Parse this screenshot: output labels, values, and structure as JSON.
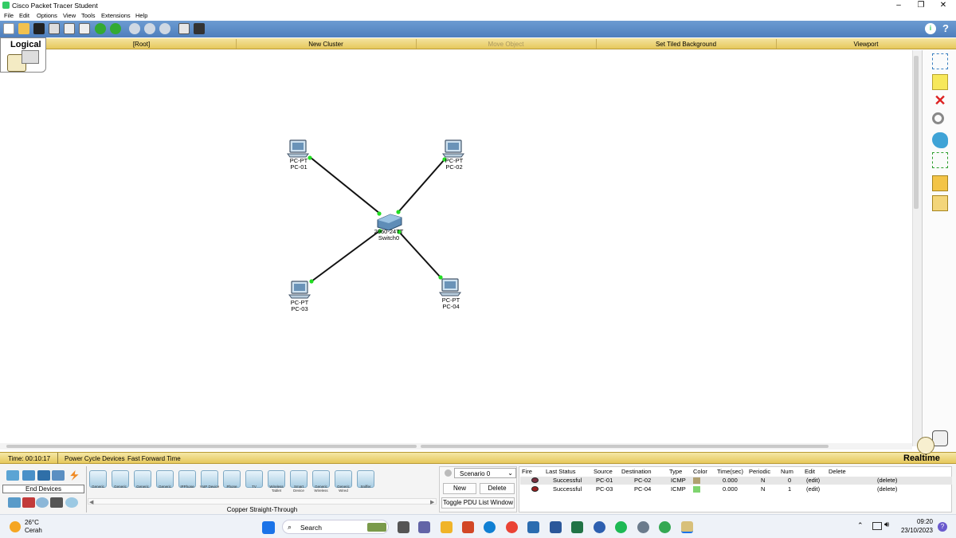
{
  "window": {
    "title": "Cisco Packet Tracer Student",
    "min": "–",
    "max": "❐",
    "close": "✕"
  },
  "menu": [
    "File",
    "Edit",
    "Options",
    "View",
    "Tools",
    "Extensions",
    "Help"
  ],
  "logical_bar": {
    "tab_label": "Logical",
    "root": "[Root]",
    "new_cluster": "New Cluster",
    "move_object": "Move Object",
    "set_tiled_background": "Set Tiled Background",
    "viewport": "Viewport"
  },
  "devices": {
    "pc01": {
      "model": "PC-PT",
      "name": "PC-01"
    },
    "pc02": {
      "model": "PC-PT",
      "name": "PC-02"
    },
    "pc03": {
      "model": "PC-PT",
      "name": "PC-03"
    },
    "pc04": {
      "model": "PC-PT",
      "name": "PC-04"
    },
    "switch": {
      "model": "2960-24TT",
      "name": "Switch0"
    }
  },
  "statusbar": {
    "time": "Time: 00:10:17",
    "power_cycle": "Power Cycle Devices",
    "fast_forward": "Fast Forward Time",
    "mode": "Realtime"
  },
  "device_panel": {
    "category_label": "End Devices",
    "connection_label": "Copper Straight-Through",
    "tiles": [
      "Generic",
      "Generic",
      "Generic",
      "Generic",
      "IPPhone",
      "VoIP Device",
      "Phone",
      "TV",
      "Wireless Tablet",
      "Smart Device",
      "Generic Wireless",
      "Generic Wired",
      "Sniffer"
    ]
  },
  "scenario": {
    "selected": "Scenario 0",
    "new": "New",
    "delete": "Delete",
    "toggle": "Toggle PDU List Window"
  },
  "pdu_table": {
    "headers": [
      "Fire",
      "Last Status",
      "Source",
      "Destination",
      "Type",
      "Color",
      "Time(sec)",
      "Periodic",
      "Num",
      "Edit",
      "Delete"
    ],
    "rows": [
      {
        "status": "Successful",
        "source": "PC-01",
        "destination": "PC-02",
        "type": "ICMP",
        "color": "#b0a070",
        "time": "0.000",
        "periodic": "N",
        "num": "0",
        "edit": "(edit)",
        "delete": "(delete)"
      },
      {
        "status": "Successful",
        "source": "PC-03",
        "destination": "PC-04",
        "type": "ICMP",
        "color": "#7fd46f",
        "time": "0.000",
        "periodic": "N",
        "num": "1",
        "edit": "(edit)",
        "delete": "(delete)"
      }
    ]
  },
  "taskbar": {
    "temp": "26°C",
    "weather": "Cerah",
    "search": "Search",
    "time": "09:20",
    "date": "23/10/2023"
  },
  "colors": {
    "link_up": "#22dd22",
    "accent_yellow": "#e6c85c",
    "toolbar_blue": "#5a88c4"
  }
}
